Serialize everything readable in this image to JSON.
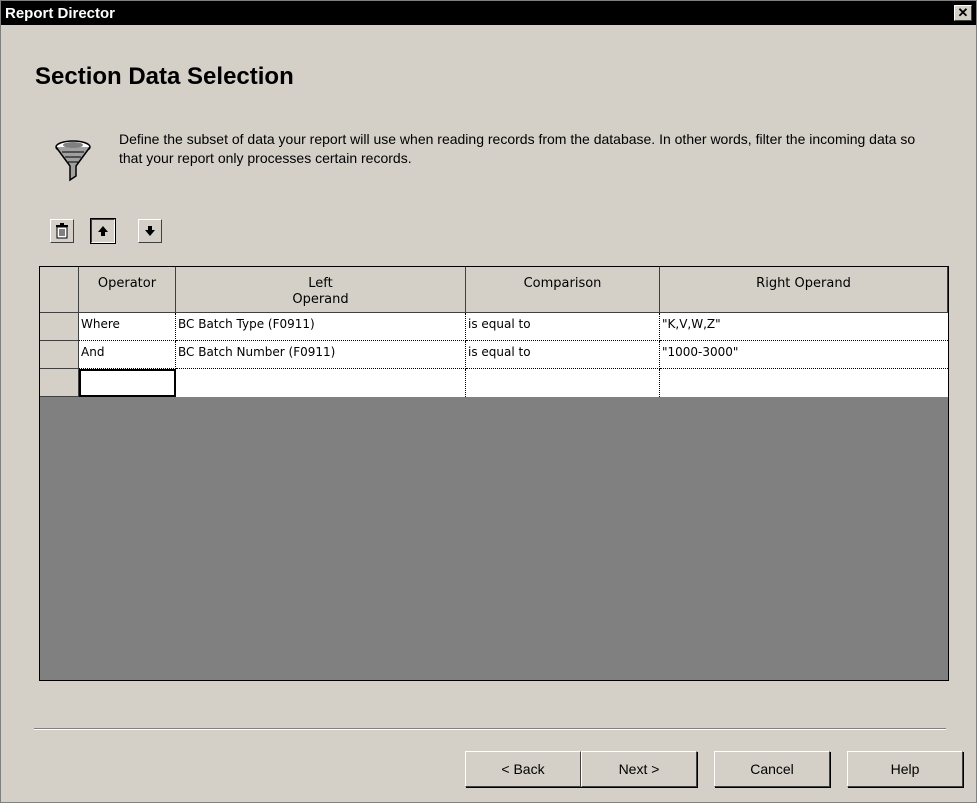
{
  "window": {
    "title": "Report Director",
    "close_glyph": "✕"
  },
  "page": {
    "heading": "Section Data Selection",
    "description": "Define the subset of data your report will use when reading records from the database.  In other words, filter the incoming data so that your report only processes certain records.",
    "icon": "funnel-filter-icon"
  },
  "toolbar": {
    "buttons": [
      {
        "name": "delete-button",
        "icon": "trash-icon"
      },
      {
        "name": "move-up-button",
        "icon": "arrow-up-icon"
      },
      {
        "name": "move-down-button",
        "icon": "arrow-down-icon"
      }
    ]
  },
  "grid": {
    "columns": [
      "Operator",
      "Left\nOperand",
      "Comparison",
      "Right Operand"
    ],
    "rows": [
      [
        "Where",
        "BC Batch Type (F0911)",
        "is equal to",
        "\"K,V,W,Z\""
      ],
      [
        "And",
        "BC Batch Number (F0911)",
        "is equal to",
        "\"1000-3000\""
      ],
      [
        "",
        "",
        "",
        ""
      ]
    ]
  },
  "buttons": {
    "back": "< Back",
    "next": "Next >",
    "cancel": "Cancel",
    "help": "Help"
  }
}
